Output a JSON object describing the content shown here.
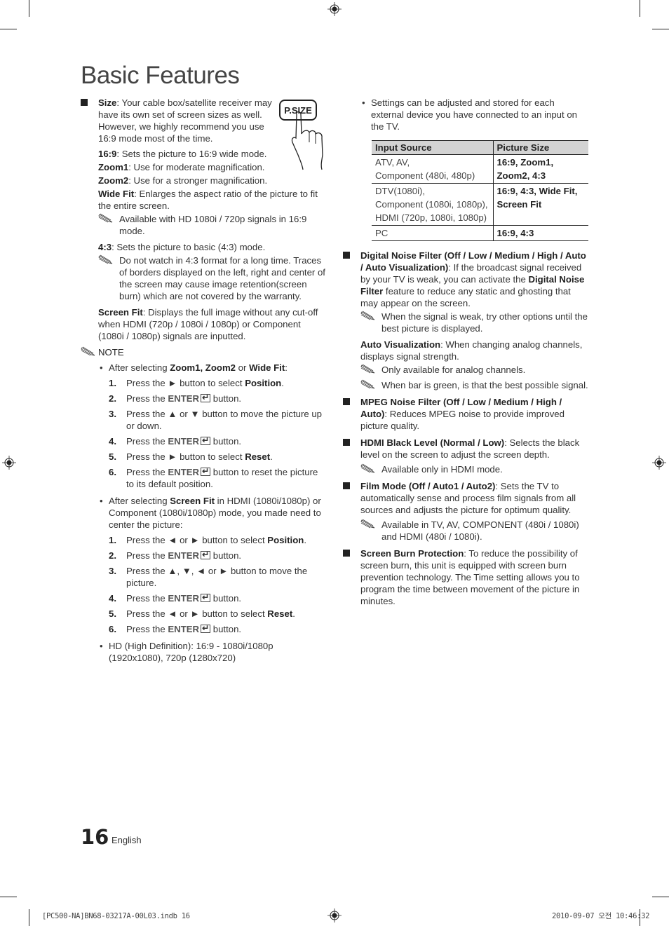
{
  "page": {
    "title": "Basic Features",
    "page_number": "16",
    "language": "English"
  },
  "left": {
    "size": {
      "label": "Size",
      "text": ": Your cable box/satellite receiver may have its own set of screen sizes as well. However, we highly recommend you use 16:9 mode most of the time.",
      "psize_button": "P.SIZE",
      "modes": [
        {
          "label": "16:9",
          "text": ": Sets the picture to 16:9 wide mode."
        },
        {
          "label": "Zoom1",
          "text": ": Use for moderate magnification."
        },
        {
          "label": "Zoom2",
          "text": ": Use for a stronger magnification."
        },
        {
          "label": "Wide Fit",
          "text": ": Enlarges the aspect ratio of the picture to fit the entire screen."
        }
      ],
      "widefit_note": "Available with HD 1080i / 720p signals in 16:9 mode.",
      "mode_43": {
        "label": "4:3",
        "text": ": Sets the picture to basic (4:3) mode."
      },
      "note_43": "Do not watch in 4:3 format for a long time. Traces of borders displayed on the left, right and center of the screen may cause image retention(screen burn) which are not covered by the warranty.",
      "screenfit": {
        "label": "Screen Fit",
        "text": ": Displays the full image without any cut-off when HDMI (720p / 1080i / 1080p) or Component (1080i / 1080p) signals are inputted."
      }
    },
    "note_heading": "NOTE",
    "bullet1": {
      "pre": "After selecting ",
      "b1": "Zoom1, Zoom2",
      "mid": " or ",
      "b2": "Wide Fit",
      "post": ":",
      "steps": [
        {
          "num": "1.",
          "pre": "Press the ► button to select ",
          "bold": "Position",
          "post": "."
        },
        {
          "num": "2.",
          "pre": "Press the ",
          "enter": "ENTER",
          "post": " button."
        },
        {
          "num": "3.",
          "pre": "Press the ▲ or ▼ button to move the picture up or down.",
          "bold": "",
          "post": ""
        },
        {
          "num": "4.",
          "pre": "Press the ",
          "enter": "ENTER",
          "post": " button."
        },
        {
          "num": "5.",
          "pre": "Press the ► button to select ",
          "bold": "Reset",
          "post": "."
        },
        {
          "num": "6.",
          "pre": "Press the ",
          "enter": "ENTER",
          "post": " button to reset the picture to its default position."
        }
      ]
    },
    "bullet2": {
      "pre": "After selecting ",
      "b1": "Screen Fit",
      "post": " in HDMI (1080i/1080p) or Component (1080i/1080p) mode, you made need to center the picture:",
      "steps": [
        {
          "num": "1.",
          "pre": "Press the ◄ or ► button to select ",
          "bold": "Position",
          "post": "."
        },
        {
          "num": "2.",
          "pre": "Press the ",
          "enter": "ENTER",
          "post": " button."
        },
        {
          "num": "3.",
          "pre": "Press the ▲, ▼, ◄ or ► button to move the picture.",
          "bold": "",
          "post": ""
        },
        {
          "num": "4.",
          "pre": "Press the ",
          "enter": "ENTER",
          "post": " button."
        },
        {
          "num": "5.",
          "pre": "Press the ◄ or ► button to select ",
          "bold": "Reset",
          "post": "."
        },
        {
          "num": "6.",
          "pre": "Press the ",
          "enter": "ENTER",
          "post": " button."
        }
      ]
    },
    "bullet3": "HD (High Definition): 16:9 - 1080i/1080p (1920x1080), 720p (1280x720)"
  },
  "right": {
    "settings_bullet": "Settings can be adjusted and stored for each external device you have connected to an input on the TV.",
    "table": {
      "headers": [
        "Input Source",
        "Picture Size"
      ],
      "rows": [
        {
          "source": [
            "ATV, AV,",
            "Component (480i, 480p)"
          ],
          "size": [
            "16:9, Zoom1,",
            "Zoom2, 4:3"
          ]
        },
        {
          "source": [
            "DTV(1080i),",
            "Component (1080i, 1080p),",
            "HDMI (720p, 1080i, 1080p)"
          ],
          "size": [
            "16:9, 4:3, Wide Fit,",
            "Screen Fit"
          ]
        },
        {
          "source": [
            "PC"
          ],
          "size": [
            "16:9, 4:3"
          ]
        }
      ]
    },
    "dnf": {
      "label": "Digital Noise Filter (Off / Low / Medium / High / Auto / Auto Visualization)",
      "text1": ": If the broadcast signal received by your TV is weak, you can activate the ",
      "bold2": "Digital Noise Filter",
      "text2": " feature to reduce any static and ghosting that may appear on the screen.",
      "note": "When the signal is weak, try other options until the best picture is displayed.",
      "autovis_label": "Auto Visualization",
      "autovis_text": ": When changing analog channels, displays signal strength.",
      "autovis_notes": [
        "Only available for analog channels.",
        "When bar is green, is that the best possible signal."
      ]
    },
    "mpeg": {
      "label": "MPEG Noise Filter (Off / Low / Medium / High / Auto)",
      "text": ": Reduces MPEG noise to provide improved picture quality."
    },
    "hdmi": {
      "label": "HDMI Black Level (Normal / Low)",
      "text": ": Selects the black level on the screen to adjust the screen depth.",
      "note": "Available only in HDMI mode."
    },
    "film": {
      "label": "Film Mode (Off / Auto1 / Auto2)",
      "text": ": Sets the TV to automatically sense and process film signals from all sources and adjusts the picture for optimum quality.",
      "note": "Available in TV, AV, COMPONENT (480i / 1080i) and HDMI (480i / 1080i)."
    },
    "burn": {
      "label": "Screen Burn Protection",
      "text": ": To reduce the possibility of screen burn, this unit is equipped with screen burn prevention technology. The Time setting allows you to program the time between movement of the picture in minutes."
    }
  },
  "slug": {
    "file": "[PC500-NA]BN68-03217A-00L03.indb   16",
    "datetime": "2010-09-07   오전 10:46:32"
  }
}
